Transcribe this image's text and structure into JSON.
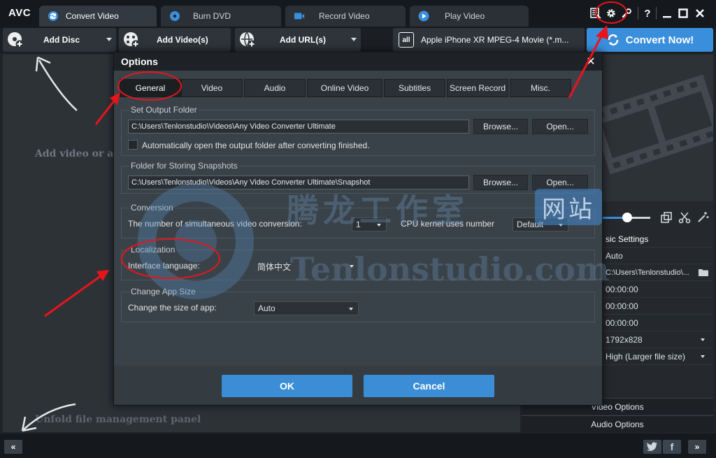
{
  "app": {
    "logo": "AVC"
  },
  "tabs": [
    {
      "label": "Convert Video",
      "icon": "convert-icon",
      "active": true
    },
    {
      "label": "Burn DVD",
      "icon": "disc-icon",
      "active": false
    },
    {
      "label": "Record Video",
      "icon": "record-icon",
      "active": false
    },
    {
      "label": "Play Video",
      "icon": "play-icon",
      "active": false
    }
  ],
  "window_controls": {
    "help": "?"
  },
  "toolbar": {
    "add_disc": "Add Disc",
    "add_videos": "Add Video(s)",
    "add_url": "Add URL(s)",
    "profile": "Apple iPhone XR MPEG-4 Movie (*.m...",
    "convert_now": "Convert Now!"
  },
  "main": {
    "hint_add": "Add video or a",
    "hint_unfold": "Unfold file management panel"
  },
  "right_panel": {
    "basic_settings": "sic Settings",
    "rows": [
      {
        "value": "Auto",
        "dropdown": false
      },
      {
        "value": "C:\\Users\\Tenlonstudio\\...",
        "dropdown": false
      },
      {
        "value": "00:00:00",
        "dropdown": false
      },
      {
        "value": "00:00:00",
        "dropdown": false
      },
      {
        "value": "00:00:00",
        "dropdown": false
      },
      {
        "value": "1792x828",
        "dropdown": true
      },
      {
        "value": "High (Larger file size)",
        "dropdown": true
      }
    ],
    "video_options": "Video Options",
    "audio_options": "Audio Options"
  },
  "dialog": {
    "title": "Options",
    "tabs": [
      "General",
      "Video",
      "Audio",
      "Online Video",
      "Subtitles",
      "Screen Record",
      "Misc."
    ],
    "output_folder": {
      "label": "Set Output Folder",
      "path": "C:\\Users\\Tenlonstudio\\Videos\\Any Video Converter Ultimate",
      "browse": "Browse...",
      "open": "Open...",
      "auto_open": "Automatically open the output folder after converting finished."
    },
    "snapshot_folder": {
      "label": "Folder for Storing Snapshots",
      "path": "C:\\Users\\Tenlonstudio\\Videos\\Any Video Converter Ultimate\\Snapshot",
      "browse": "Browse...",
      "open": "Open..."
    },
    "conversion": {
      "label": "Conversion",
      "simultaneous_label": "The number of simultaneous video conversion:",
      "simultaneous_value": "1",
      "cpu_label": "CPU kernel uses number",
      "cpu_value": "Default"
    },
    "localization": {
      "label": "Localization",
      "interface_label": "Interface language:",
      "interface_value": "简体中文"
    },
    "app_size": {
      "label": "Change App Size",
      "size_label": "Change the size of app:",
      "size_value": "Auto"
    },
    "ok": "OK",
    "cancel": "Cancel"
  },
  "watermark": {
    "cn": "腾龙工作室",
    "cn_box": "网站",
    "en": "Tenlonstudio.com"
  },
  "colors": {
    "accent": "#3a8fdc",
    "annotation": "#e8141c"
  }
}
